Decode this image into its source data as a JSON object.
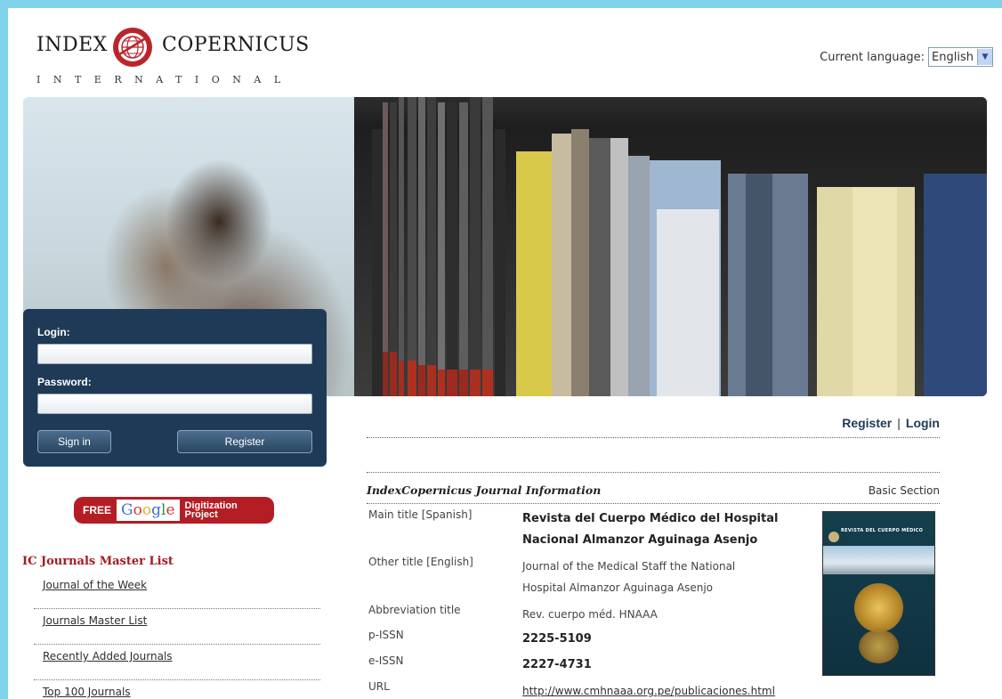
{
  "header": {
    "logo_left": "INDEX",
    "logo_right": "COPERNICUS",
    "logo_sub": "INTERNATIONAL",
    "language_label": "Current language:",
    "language_value": "English"
  },
  "login": {
    "login_label": "Login:",
    "password_label": "Password:",
    "signin_label": "Sign in",
    "register_label": "Register"
  },
  "google_badge": {
    "free": "FREE",
    "google": "Google",
    "line1": "Digitization",
    "line2": "Project"
  },
  "sidebar": {
    "title": "IC Journals Master List",
    "items": [
      {
        "label": "Journal of the Week"
      },
      {
        "label": "Journals Master List"
      },
      {
        "label": "Recently Added Journals"
      },
      {
        "label": "Top 100 Journals"
      }
    ]
  },
  "top_links": {
    "register": "Register",
    "separator": "|",
    "login": "Login"
  },
  "journal": {
    "heading": "IndexCopernicus Journal Information",
    "section": "Basic Section",
    "rows": [
      {
        "key": "Main title [Spanish]",
        "value": "Revista del Cuerpo Médico del Hospital Nacional Almanzor Aguinaga Asenjo"
      },
      {
        "key": "Other title [English]",
        "value": "Journal of the Medical Staff the National Hospital Almanzor Aguinaga Asenjo"
      },
      {
        "key": "Abbreviation title",
        "value": "Rev. cuerpo méd. HNAAA"
      },
      {
        "key": "p-ISSN",
        "value": "2225-5109"
      },
      {
        "key": "e-ISSN",
        "value": "2227-4731"
      },
      {
        "key": "URL",
        "value": "http://www.cmhnaaa.org.pe/publicaciones.html"
      }
    ],
    "cover_title": "REVISTA DEL CUERPO MÉDICO"
  }
}
